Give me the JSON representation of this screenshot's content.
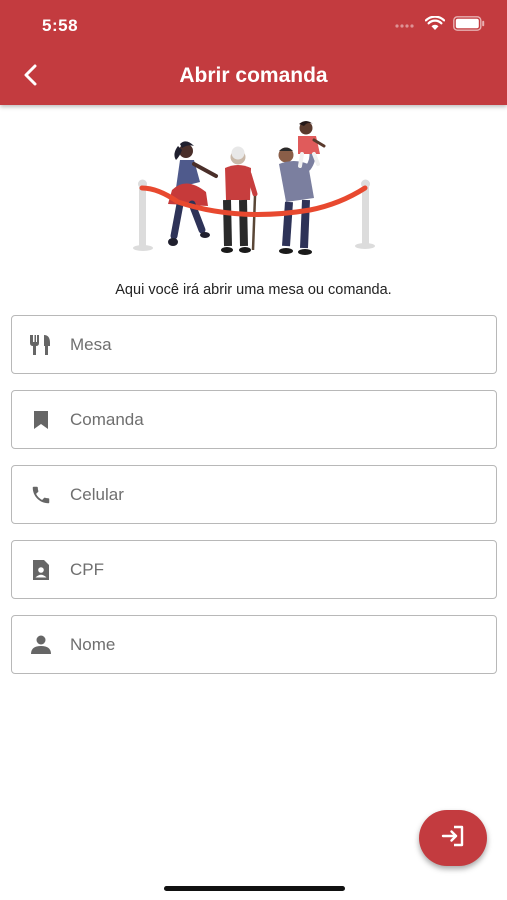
{
  "status": {
    "time": "5:58"
  },
  "header": {
    "title": "Abrir comanda",
    "back_icon": "back-arrow-icon"
  },
  "description": "Aqui você irá abrir uma mesa ou comanda.",
  "form": {
    "fields": [
      {
        "id": "mesa",
        "placeholder": "Mesa",
        "value": "",
        "icon": "utensils-icon"
      },
      {
        "id": "comanda",
        "placeholder": "Comanda",
        "value": "",
        "icon": "bookmark-icon"
      },
      {
        "id": "celular",
        "placeholder": "Celular",
        "value": "",
        "icon": "phone-icon"
      },
      {
        "id": "cpf",
        "placeholder": "CPF",
        "value": "",
        "icon": "id-card-icon"
      },
      {
        "id": "nome",
        "placeholder": "Nome",
        "value": "",
        "icon": "person-icon"
      }
    ]
  },
  "fab": {
    "icon": "login-icon"
  },
  "colors": {
    "primary": "#c33b3f",
    "ribbon": "#e8492f"
  }
}
